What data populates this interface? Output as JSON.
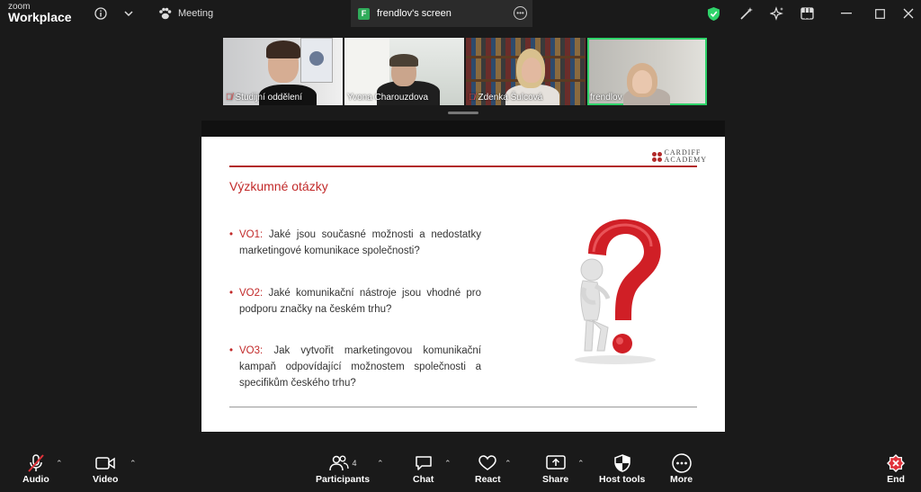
{
  "app": {
    "logo_top": "zoom",
    "logo_bottom": "Workplace"
  },
  "top": {
    "meeting_label": "Meeting",
    "screen_tab": {
      "badge": "F",
      "label": "frendlov's screen"
    }
  },
  "participants_strip": [
    {
      "name": "Studijní oddělení",
      "muted": true
    },
    {
      "name": "Yvona Charouzdova",
      "muted": false
    },
    {
      "name": "Zdenka Šulcová",
      "muted": true
    },
    {
      "name": "frendlov",
      "muted": false,
      "active_speaker": true
    }
  ],
  "slide": {
    "brand_line1": "CARDIFF",
    "brand_line2": "ACADEMY",
    "title": "Výzkumné otázky",
    "questions": [
      {
        "label": "VO1:",
        "text": " Jaké jsou současné možnosti a nedostatky marketingové komunikace společnosti?"
      },
      {
        "label": "VO2:",
        "text": " Jaké komunikační nástroje jsou vhodné pro podporu značky na českém trhu?"
      },
      {
        "label": "VO3:",
        "text": " Jak vytvořit marketingovou komunikační kampaň odpovídající možnostem společnosti a specifikům českého trhu?"
      }
    ]
  },
  "toolbar": {
    "audio": "Audio",
    "video": "Video",
    "participants": "Participants",
    "participants_count": "4",
    "chat": "Chat",
    "react": "React",
    "share": "Share",
    "host_tools": "Host tools",
    "more": "More",
    "end": "End"
  },
  "colors": {
    "accent_green": "#2fd36a",
    "end_red": "#e0323a",
    "slide_red": "#c22a2a"
  }
}
